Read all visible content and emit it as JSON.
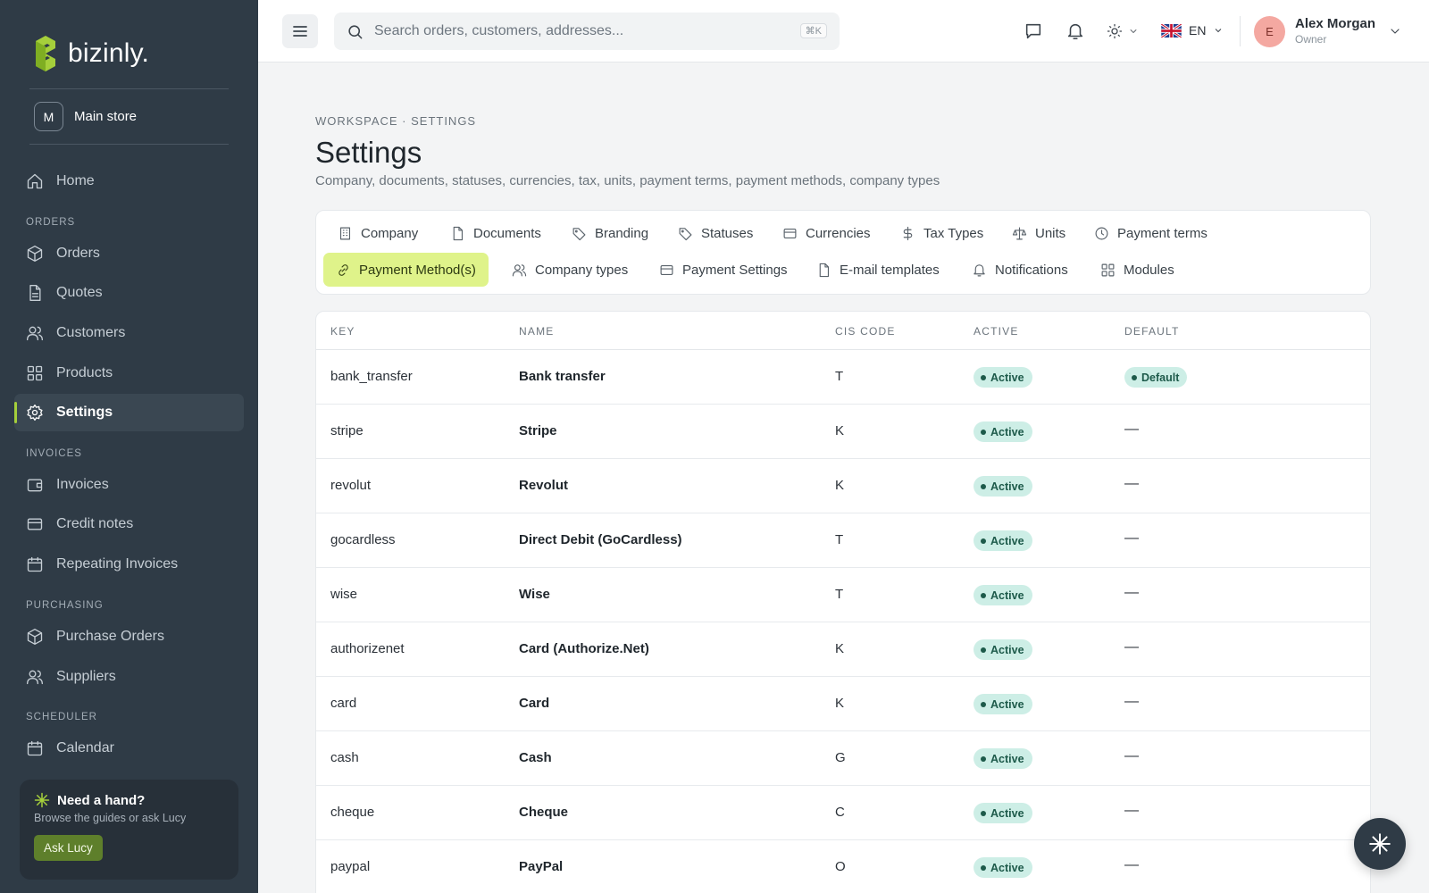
{
  "brand": {
    "name": "bizinly."
  },
  "store": {
    "badge": "M",
    "name": "Main store"
  },
  "sidebar": {
    "home": "Home",
    "section_orders": "ORDERS",
    "orders": "Orders",
    "quotes": "Quotes",
    "customers": "Customers",
    "products": "Products",
    "settings": "Settings",
    "section_invoices": "INVOICES",
    "invoices": "Invoices",
    "credit_notes": "Credit notes",
    "repeating_invoices": "Repeating Invoices",
    "section_purchasing": "PURCHASING",
    "purchase_orders": "Purchase Orders",
    "suppliers": "Suppliers",
    "section_scheduler": "SCHEDULER",
    "calendar": "Calendar"
  },
  "help": {
    "title": "Need a hand?",
    "subtitle": "Browse the guides or ask Lucy",
    "button": "Ask Lucy"
  },
  "topbar": {
    "search_placeholder": "Search orders, customers, addresses...",
    "shortcut": "⌘K",
    "language": "EN",
    "user_initial": "E",
    "user_name": "Alex Morgan",
    "user_role": "Owner"
  },
  "page": {
    "breadcrumb": "WORKSPACE · SETTINGS",
    "title": "Settings",
    "subtitle": "Company, documents, statuses, currencies, tax, units, payment terms, payment methods, company types"
  },
  "tabs": {
    "company": "Company",
    "documents": "Documents",
    "branding": "Branding",
    "statuses": "Statuses",
    "currencies": "Currencies",
    "tax_types": "Tax Types",
    "units": "Units",
    "payment_terms": "Payment terms",
    "payment_methods": "Payment Method(s)",
    "company_types": "Company types",
    "payment_settings": "Payment Settings",
    "email_templates": "E-mail templates",
    "notifications": "Notifications",
    "modules": "Modules"
  },
  "table": {
    "headers": {
      "key": "KEY",
      "name": "NAME",
      "cis": "CIS CODE",
      "active": "ACTIVE",
      "default": "DEFAULT"
    },
    "rows": [
      {
        "key": "bank_transfer",
        "name": "Bank transfer",
        "cis": "T",
        "active": "Active",
        "default": "Default"
      },
      {
        "key": "stripe",
        "name": "Stripe",
        "cis": "K",
        "active": "Active",
        "default": "—"
      },
      {
        "key": "revolut",
        "name": "Revolut",
        "cis": "K",
        "active": "Active",
        "default": "—"
      },
      {
        "key": "gocardless",
        "name": "Direct Debit (GoCardless)",
        "cis": "T",
        "active": "Active",
        "default": "—"
      },
      {
        "key": "wise",
        "name": "Wise",
        "cis": "T",
        "active": "Active",
        "default": "—"
      },
      {
        "key": "authorizenet",
        "name": "Card (Authorize.Net)",
        "cis": "K",
        "active": "Active",
        "default": "—"
      },
      {
        "key": "card",
        "name": "Card",
        "cis": "K",
        "active": "Active",
        "default": "—"
      },
      {
        "key": "cash",
        "name": "Cash",
        "cis": "G",
        "active": "Active",
        "default": "—"
      },
      {
        "key": "cheque",
        "name": "Cheque",
        "cis": "C",
        "active": "Active",
        "default": "—"
      },
      {
        "key": "paypal",
        "name": "PayPal",
        "cis": "O",
        "active": "Active",
        "default": "—"
      }
    ]
  },
  "colors": {
    "sidebar": "#2f3b46",
    "accent": "#a5cf3b",
    "active_tab": "#dff38a",
    "pill": "#cdeee6"
  }
}
